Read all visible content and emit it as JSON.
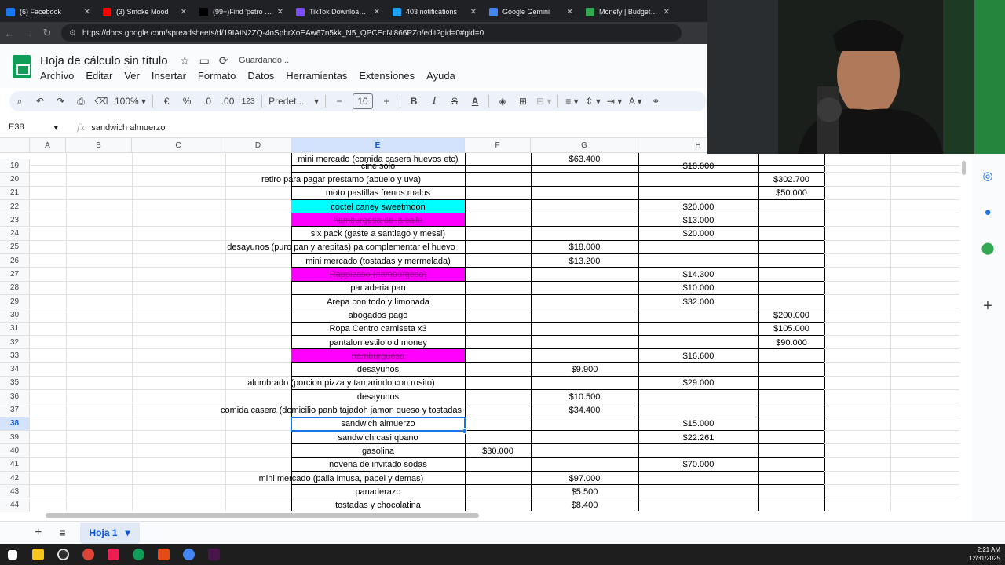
{
  "browser": {
    "tabs": [
      {
        "title": "(6) Facebook",
        "color": "#1877f2"
      },
      {
        "title": "(3) Smoke Mood",
        "color": "#ff0000"
      },
      {
        "title": "(99+)Find 'petro anu",
        "color": "#000000"
      },
      {
        "title": "TikTok Downloader -",
        "color": "#7b4dff"
      },
      {
        "title": "403 notifications",
        "color": "#1da1f2"
      },
      {
        "title": "Google Gemini",
        "color": "#4285f4"
      },
      {
        "title": "Monefy | Budget & Tr",
        "color": "#34a853"
      }
    ],
    "url": "https://docs.google.com/spreadsheets/d/19IAtN2ZQ-4oSphrXoEAw67n5kk_N5_QPCEcNi866PZo/edit?gid=0#gid=0"
  },
  "doc": {
    "title": "Hoja de cálculo sin título",
    "status": "Guardando...",
    "menu": [
      "Archivo",
      "Editar",
      "Ver",
      "Insertar",
      "Formato",
      "Datos",
      "Herramientas",
      "Extensiones",
      "Ayuda"
    ]
  },
  "toolbar": {
    "zoom": "100%",
    "currency": "€",
    "percent": "%",
    "dec_decrease": ".0",
    "dec_increase": ".00",
    "number_format": "123",
    "font": "Predet...",
    "font_size": "10",
    "bold": "B",
    "italic": "I",
    "strike": "S",
    "textcolor": "A"
  },
  "formula": {
    "cell_ref": "E38",
    "fx": "fx",
    "content": "sandwich almuerzo"
  },
  "columns": [
    "A",
    "B",
    "C",
    "D",
    "E",
    "F",
    "G",
    "H"
  ],
  "selected": {
    "column": "E",
    "row": "38"
  },
  "top_partial_row": {
    "e": "mini mercado (comida casera huevos etc)",
    "g": "$63.400"
  },
  "rows": [
    {
      "n": "19",
      "e": "cine solo",
      "f": "",
      "g": "",
      "h": "$18.000",
      "i": "",
      "bg": ""
    },
    {
      "n": "20",
      "e": "retiro para pagar prestamo (abuelo y uva)",
      "f": "",
      "g": "",
      "h": "",
      "i": "$302.700",
      "bg": ""
    },
    {
      "n": "21",
      "e": "moto pastillas frenos malos",
      "f": "",
      "g": "",
      "h": "",
      "i": "$50.000",
      "bg": ""
    },
    {
      "n": "22",
      "e": "coctel caney sweetmoon",
      "f": "",
      "g": "",
      "h": "$20.000",
      "i": "",
      "bg": "#00ffff"
    },
    {
      "n": "23",
      "e": "hamburgesa de la calle",
      "f": "",
      "g": "",
      "h": "$13.000",
      "i": "",
      "bg": "#ff00ff"
    },
    {
      "n": "24",
      "e": "six pack (gaste a santiago y messi)",
      "f": "",
      "g": "",
      "h": "$20.000",
      "i": "",
      "bg": ""
    },
    {
      "n": "25",
      "e": "desayunos (puro pan y arepitas) pa complementar el huevo",
      "f": "",
      "g": "$18.000",
      "h": "",
      "i": "",
      "bg": ""
    },
    {
      "n": "26",
      "e": "mini mercado (tostadas y mermelada)",
      "f": "",
      "g": "$13.200",
      "h": "",
      "i": "",
      "bg": ""
    },
    {
      "n": "27",
      "e": "Rappizaso (hamburgesa)",
      "f": "",
      "g": "",
      "h": "$14.300",
      "i": "",
      "bg": "#ff00ff"
    },
    {
      "n": "28",
      "e": "panaderia pan",
      "f": "",
      "g": "",
      "h": "$10.000",
      "i": "",
      "bg": ""
    },
    {
      "n": "29",
      "e": "Arepa con todo y limonada",
      "f": "",
      "g": "",
      "h": "$32.000",
      "i": "",
      "bg": ""
    },
    {
      "n": "30",
      "e": "abogados pago",
      "f": "",
      "g": "",
      "h": "",
      "i": "$200.000",
      "bg": ""
    },
    {
      "n": "31",
      "e": "Ropa Centro camiseta x3",
      "f": "",
      "g": "",
      "h": "",
      "i": "$105.000",
      "bg": ""
    },
    {
      "n": "32",
      "e": "pantalon estilo old money",
      "f": "",
      "g": "",
      "h": "",
      "i": "$90.000",
      "bg": ""
    },
    {
      "n": "33",
      "e": "hamburguesa",
      "f": "",
      "g": "",
      "h": "$16.600",
      "i": "",
      "bg": "#ff00ff"
    },
    {
      "n": "34",
      "e": "desayunos",
      "f": "",
      "g": "$9.900",
      "h": "",
      "i": "",
      "bg": ""
    },
    {
      "n": "35",
      "e": "alumbrado (porcion pizza y tamarindo con rosito)",
      "f": "",
      "g": "",
      "h": "$29.000",
      "i": "",
      "bg": ""
    },
    {
      "n": "36",
      "e": "desayunos",
      "f": "",
      "g": "$10.500",
      "h": "",
      "i": "",
      "bg": ""
    },
    {
      "n": "37",
      "e": "comida casera (domicilio panb tajadoh jamon queso y tostadas",
      "f": "",
      "g": "$34.400",
      "h": "",
      "i": "",
      "bg": ""
    },
    {
      "n": "38",
      "e": "sandwich almuerzo",
      "f": "",
      "g": "",
      "h": "$15.000",
      "i": "",
      "bg": ""
    },
    {
      "n": "39",
      "e": "sandwich casi qbano",
      "f": "",
      "g": "",
      "h": "$22.261",
      "i": "",
      "bg": ""
    },
    {
      "n": "40",
      "e": "gasolina",
      "f": "$30.000",
      "g": "",
      "h": "",
      "i": "",
      "bg": ""
    },
    {
      "n": "41",
      "e": "novena de invitado sodas",
      "f": "",
      "g": "",
      "h": "$70.000",
      "i": "",
      "bg": ""
    },
    {
      "n": "42",
      "e": "mini mercado (paila imusa, papel y demas)",
      "f": "",
      "g": "$97.000",
      "h": "",
      "i": "",
      "bg": ""
    },
    {
      "n": "43",
      "e": "panaderazo",
      "f": "",
      "g": "$5.500",
      "h": "",
      "i": "",
      "bg": ""
    },
    {
      "n": "44",
      "e": "tostadas y chocolatina",
      "f": "",
      "g": "$8.400",
      "h": "",
      "i": "",
      "bg": ""
    }
  ],
  "sheets": [
    {
      "name": "Hoja 1"
    }
  ],
  "taskbar": {
    "time": "2:21 AM",
    "date": "12/31/2025"
  }
}
